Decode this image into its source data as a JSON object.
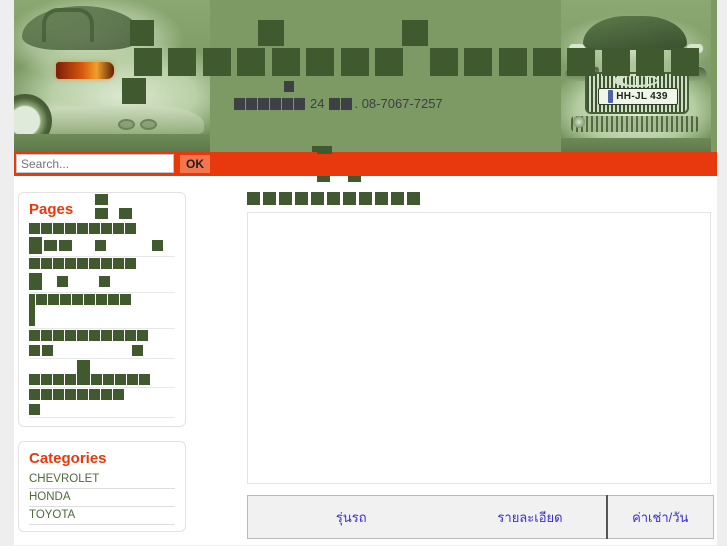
{
  "site": {
    "banner_bg": "#7d9964",
    "accent_orange": "#e8380d",
    "redaction_green": "#41592f",
    "redaction_dark": "#3d4044",
    "tagline_prefix_blocks": 6,
    "tagline_number": "24",
    "tagline_mid_blocks": 2,
    "tagline_phone": ". 08-7067-7257",
    "plate_text": "HH-JL 439"
  },
  "search": {
    "value": "",
    "placeholder": "Search...",
    "ok_label": "OK"
  },
  "sidebar": {
    "pages_widget": {
      "title": "Pages",
      "items": [
        {
          "line1_blocks": [
            9,
            9,
            9,
            9,
            9,
            9,
            9,
            9,
            9
          ],
          "line2_blocks": [
            13,
            9,
            9
          ]
        },
        {
          "line1_blocks": [
            9,
            9,
            9,
            9,
            9,
            9,
            9,
            9,
            9
          ],
          "line2_blocks": [
            13
          ]
        },
        {
          "line1_blocks": [
            9,
            9,
            9,
            9,
            9,
            9,
            9,
            9,
            9
          ],
          "line2_blocks": [
            13,
            20
          ]
        },
        {
          "line1_blocks": [
            9,
            9,
            9,
            9,
            9,
            9,
            9,
            9,
            9,
            9
          ],
          "line2_blocks": [
            9,
            9
          ]
        },
        {
          "line1_blocks": [
            9,
            9,
            9,
            9,
            15,
            9,
            9,
            9,
            9,
            9
          ],
          "line2_blocks": []
        },
        {
          "line1_blocks": [
            9,
            9,
            9,
            9,
            9,
            9,
            9,
            9,
            9
          ],
          "line2_blocks": [
            9
          ]
        }
      ]
    },
    "categories_widget": {
      "title": "Categories",
      "items": [
        "CHEVROLET",
        "HONDA",
        "TOYOTA"
      ]
    }
  },
  "main": {
    "page_title_blocks": [
      13,
      13,
      13,
      13,
      13,
      13,
      13,
      13,
      13,
      13,
      13
    ],
    "content_box_text": "",
    "table": {
      "headers": [
        "รุ่นรถ",
        "รายละเอียด",
        "ค่าเช่า/วัน"
      ],
      "rows": []
    }
  },
  "icons": {
    "search": "search-icon",
    "audi-rings": "audi-rings-icon"
  }
}
